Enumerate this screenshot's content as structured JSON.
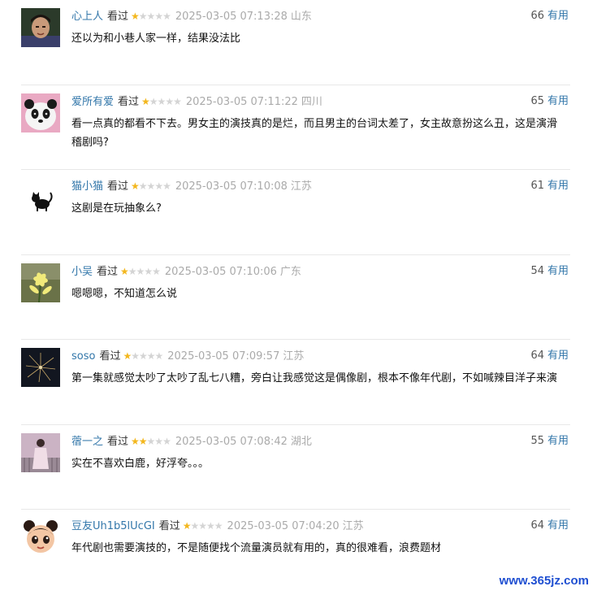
{
  "comments": [
    {
      "user": "心上人",
      "status": "看过",
      "stars_on": "★",
      "stars_off": "★★★★",
      "rating": 1,
      "time": "2025-03-05 07:13:28",
      "location": "山东",
      "votes": "66",
      "useful": "有用",
      "text": "还以为和小巷人家一样，结果没法比"
    },
    {
      "user": "爱所有爱",
      "status": "看过",
      "stars_on": "★",
      "stars_off": "★★★★",
      "rating": 1,
      "time": "2025-03-05 07:11:22",
      "location": "四川",
      "votes": "65",
      "useful": "有用",
      "text": "看一点真的都看不下去。男女主的演技真的是烂，而且男主的台词太差了，女主故意扮这么丑，这是演滑稽剧吗?"
    },
    {
      "user": "猫小猫",
      "status": "看过",
      "stars_on": "★",
      "stars_off": "★★★★",
      "rating": 1,
      "time": "2025-03-05 07:10:08",
      "location": "江苏",
      "votes": "61",
      "useful": "有用",
      "text": "这剧是在玩抽象么?"
    },
    {
      "user": "小吴",
      "status": "看过",
      "stars_on": "★",
      "stars_off": "★★★★",
      "rating": 1,
      "time": "2025-03-05 07:10:06",
      "location": "广东",
      "votes": "54",
      "useful": "有用",
      "text": "嗯嗯嗯，不知道怎么说"
    },
    {
      "user": "soso",
      "status": "看过",
      "stars_on": "★",
      "stars_off": "★★★★",
      "rating": 1,
      "time": "2025-03-05 07:09:57",
      "location": "江苏",
      "votes": "64",
      "useful": "有用",
      "text": "第一集就感觉太吵了太吵了乱七八糟，旁白让我感觉这是偶像剧，根本不像年代剧，不如喊辣目洋子来演"
    },
    {
      "user": "蓿一之",
      "status": "看过",
      "stars_on": "★★",
      "stars_off": "★★★",
      "rating": 2,
      "time": "2025-03-05 07:08:42",
      "location": "湖北",
      "votes": "55",
      "useful": "有用",
      "text": "实在不喜欢白鹿，好浮夸。。。"
    },
    {
      "user": "豆友Uh1b5lUcGI",
      "status": "看过",
      "stars_on": "★",
      "stars_off": "★★★★",
      "rating": 1,
      "time": "2025-03-05 07:04:20",
      "location": "江苏",
      "votes": "64",
      "useful": "有用",
      "text": "年代剧也需要演技的，不是随便找个流量演员就有用的，真的很难看，浪费题材"
    }
  ],
  "watermark": "www.365jz.com"
}
